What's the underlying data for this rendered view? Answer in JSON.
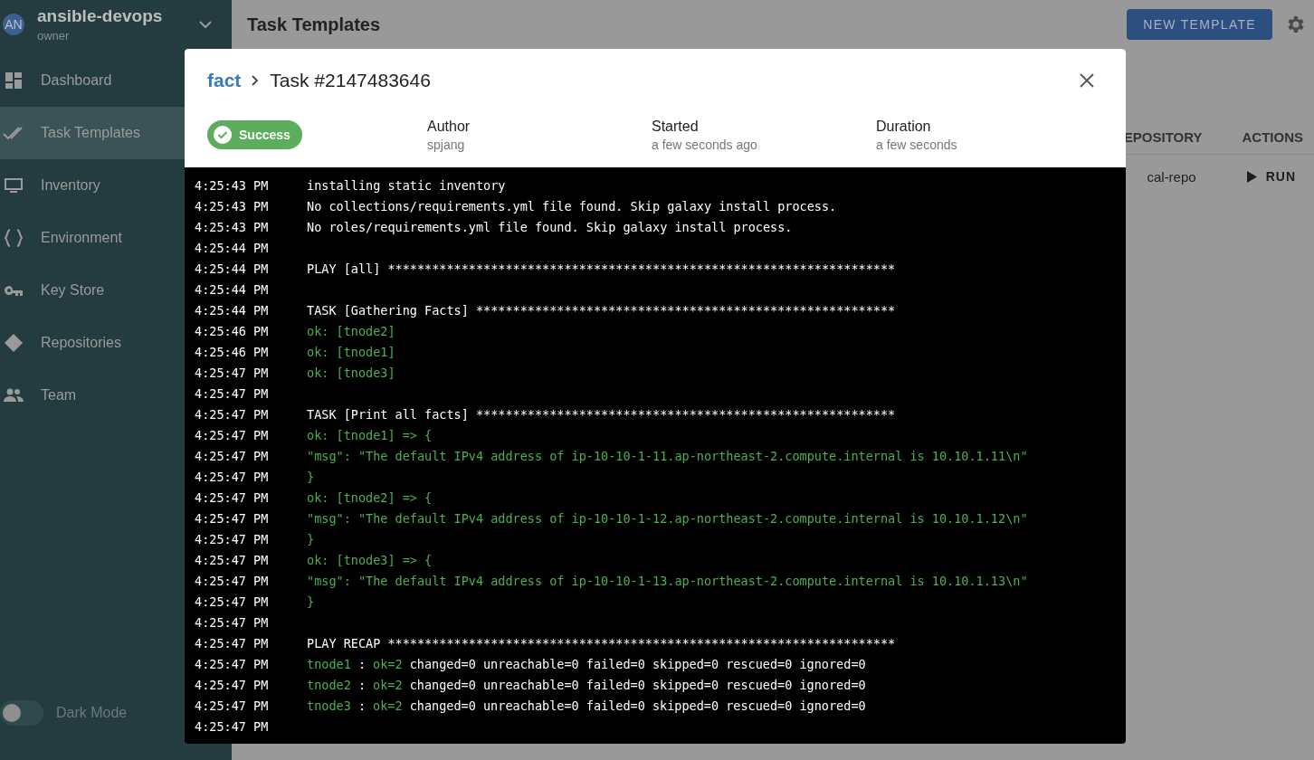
{
  "sidebar": {
    "project": "ansible-devops",
    "role": "owner",
    "avatar": "AN",
    "items": [
      {
        "label": "Dashboard",
        "selected": false
      },
      {
        "label": "Task Templates",
        "selected": true
      },
      {
        "label": "Inventory",
        "selected": false
      },
      {
        "label": "Environment",
        "selected": false
      },
      {
        "label": "Key Store",
        "selected": false
      },
      {
        "label": "Repositories",
        "selected": false
      },
      {
        "label": "Team",
        "selected": false
      }
    ],
    "dark_mode": {
      "label": "Dark Mode",
      "on": false
    }
  },
  "page": {
    "title": "Task Templates",
    "new_button": "NEW TEMPLATE",
    "columns": [
      "EPOSITORY",
      "ACTIONS"
    ],
    "row": {
      "repository": "cal-repo",
      "action": "RUN"
    }
  },
  "dialog": {
    "breadcrumb": "fact",
    "title": "Task #2147483646",
    "status": "Success",
    "meta": [
      {
        "label": "Author",
        "value": "spjang"
      },
      {
        "label": "Started",
        "value": "a few seconds ago"
      },
      {
        "label": "Duration",
        "value": "a few seconds"
      }
    ],
    "log": [
      {
        "time": "4:25:43 PM",
        "parts": [
          {
            "text": "installing static inventory",
            "kind": "plain"
          }
        ]
      },
      {
        "time": "4:25:43 PM",
        "parts": [
          {
            "text": "No collections/requirements.yml file found. Skip galaxy install process.",
            "kind": "plain"
          }
        ]
      },
      {
        "time": "4:25:43 PM",
        "parts": [
          {
            "text": "No roles/requirements.yml file found. Skip galaxy install process.",
            "kind": "plain"
          }
        ]
      },
      {
        "time": "4:25:44 PM"
      },
      {
        "time": "4:25:44 PM",
        "parts": [
          {
            "text": "PLAY [all] *********************************************************************",
            "kind": "plain"
          }
        ]
      },
      {
        "time": "4:25:44 PM"
      },
      {
        "time": "4:25:44 PM",
        "parts": [
          {
            "text": "TASK [Gathering Facts] *********************************************************",
            "kind": "plain"
          }
        ]
      },
      {
        "time": "4:25:46 PM",
        "parts": [
          {
            "text": "ok: [tnode2]",
            "kind": "ok"
          }
        ]
      },
      {
        "time": "4:25:46 PM",
        "parts": [
          {
            "text": "ok: [tnode1]",
            "kind": "ok"
          }
        ]
      },
      {
        "time": "4:25:47 PM",
        "parts": [
          {
            "text": "ok: [tnode3]",
            "kind": "ok"
          }
        ]
      },
      {
        "time": "4:25:47 PM"
      },
      {
        "time": "4:25:47 PM",
        "parts": [
          {
            "text": "TASK [Print all facts] *********************************************************",
            "kind": "plain"
          }
        ]
      },
      {
        "time": "4:25:47 PM",
        "parts": [
          {
            "text": "ok: [tnode1] => {",
            "kind": "ok"
          }
        ]
      },
      {
        "time": "4:25:47 PM",
        "parts": [
          {
            "text": "\"msg\": \"The default IPv4 address of ip-10-10-1-11.ap-northeast-2.compute.internal is 10.10.1.11\\n\"",
            "kind": "ok"
          }
        ]
      },
      {
        "time": "4:25:47 PM",
        "parts": [
          {
            "text": "}",
            "kind": "ok"
          }
        ]
      },
      {
        "time": "4:25:47 PM",
        "parts": [
          {
            "text": "ok: [tnode2] => {",
            "kind": "ok"
          }
        ]
      },
      {
        "time": "4:25:47 PM",
        "parts": [
          {
            "text": "\"msg\": \"The default IPv4 address of ip-10-10-1-12.ap-northeast-2.compute.internal is 10.10.1.12\\n\"",
            "kind": "ok"
          }
        ]
      },
      {
        "time": "4:25:47 PM",
        "parts": [
          {
            "text": "}",
            "kind": "ok"
          }
        ]
      },
      {
        "time": "4:25:47 PM",
        "parts": [
          {
            "text": "ok: [tnode3] => {",
            "kind": "ok"
          }
        ]
      },
      {
        "time": "4:25:47 PM",
        "parts": [
          {
            "text": "\"msg\": \"The default IPv4 address of ip-10-10-1-13.ap-northeast-2.compute.internal is 10.10.1.13\\n\"",
            "kind": "ok"
          }
        ]
      },
      {
        "time": "4:25:47 PM",
        "parts": [
          {
            "text": "}",
            "kind": "ok"
          }
        ]
      },
      {
        "time": "4:25:47 PM"
      },
      {
        "time": "4:25:47 PM",
        "parts": [
          {
            "text": "PLAY RECAP *********************************************************************",
            "kind": "plain"
          }
        ]
      },
      {
        "time": "4:25:47 PM",
        "parts": [
          {
            "text": "tnode1",
            "kind": "ok"
          },
          {
            "text": ":",
            "kind": "plain"
          },
          {
            "text": "ok=2",
            "kind": "ok"
          },
          {
            "text": "changed=0 unreachable=0 failed=0 skipped=0 rescued=0 ignored=0",
            "kind": "plain"
          }
        ]
      },
      {
        "time": "4:25:47 PM",
        "parts": [
          {
            "text": "tnode2",
            "kind": "ok"
          },
          {
            "text": ":",
            "kind": "plain"
          },
          {
            "text": "ok=2",
            "kind": "ok"
          },
          {
            "text": "changed=0 unreachable=0 failed=0 skipped=0 rescued=0 ignored=0",
            "kind": "plain"
          }
        ]
      },
      {
        "time": "4:25:47 PM",
        "parts": [
          {
            "text": "tnode3",
            "kind": "ok"
          },
          {
            "text": ":",
            "kind": "plain"
          },
          {
            "text": "ok=2",
            "kind": "ok"
          },
          {
            "text": "changed=0 unreachable=0 failed=0 skipped=0 rescued=0 ignored=0",
            "kind": "plain"
          }
        ]
      },
      {
        "time": "4:25:47 PM"
      }
    ]
  }
}
